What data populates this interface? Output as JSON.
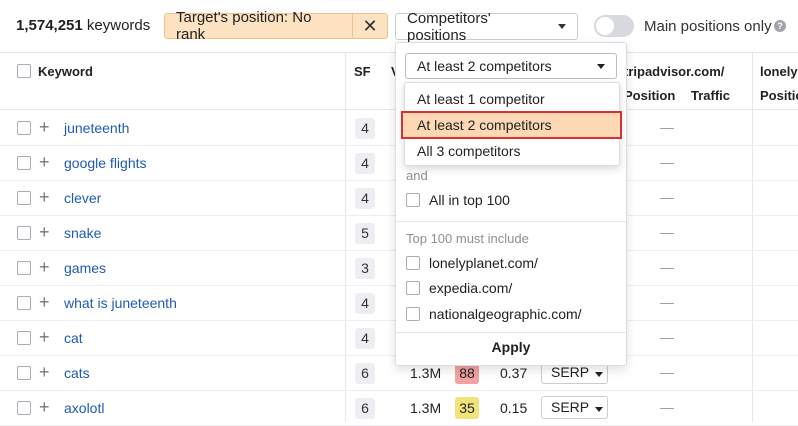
{
  "toolbar": {
    "keyword_count": "1,574,251",
    "keyword_count_suffix": " keywords",
    "target_chip_label": "Target's position: No rank",
    "close_symbol": "✕",
    "competitors_button": "Competitors' positions",
    "main_positions_label": "Main positions only",
    "help_symbol": "?"
  },
  "table": {
    "headers": {
      "keyword": "Keyword",
      "sf": "SF",
      "v": "V",
      "tripadvisor": "tripadvisor.com/",
      "position": "Position",
      "traffic": "Traffic",
      "lonely": "lonely",
      "lonely_position": "Positio"
    },
    "rows": [
      {
        "keyword": "juneteenth",
        "sf": "4",
        "dash": "—"
      },
      {
        "keyword": "google flights",
        "sf": "4",
        "dash": "—"
      },
      {
        "keyword": "clever",
        "sf": "4",
        "dash": "—"
      },
      {
        "keyword": "snake",
        "sf": "5",
        "dash": "—"
      },
      {
        "keyword": "games",
        "sf": "3",
        "dash": "—"
      },
      {
        "keyword": "what is juneteenth",
        "sf": "4",
        "dash": "—"
      },
      {
        "keyword": "cat",
        "sf": "4",
        "dash": "—"
      },
      {
        "keyword": "cats",
        "sf": "6",
        "volume": "1.3M",
        "kd": "88",
        "kd_color": "#f2a3a0",
        "cpc": "0.37",
        "serp": "SERP",
        "dash": "—"
      },
      {
        "keyword": "axolotl",
        "sf": "6",
        "volume": "1.3M",
        "kd": "35",
        "kd_color": "#f2e27a",
        "cpc": "0.15",
        "serp": "SERP",
        "dash": "—"
      }
    ]
  },
  "dropdown": {
    "selected": "At least 2 competitors",
    "options": [
      "At least 1 competitor",
      "At least 2 competitors",
      "All 3 competitors"
    ],
    "and_label": "and",
    "all_top100": "All in top 100",
    "must_include_label": "Top 100 must include",
    "domains": [
      "lonelyplanet.com/",
      "expedia.com/",
      "nationalgeographic.com/"
    ],
    "apply": "Apply"
  },
  "colors": {
    "accent_orange": "#fde2c2",
    "highlight_red": "#d9302d",
    "link_blue": "#1f5bb3"
  }
}
